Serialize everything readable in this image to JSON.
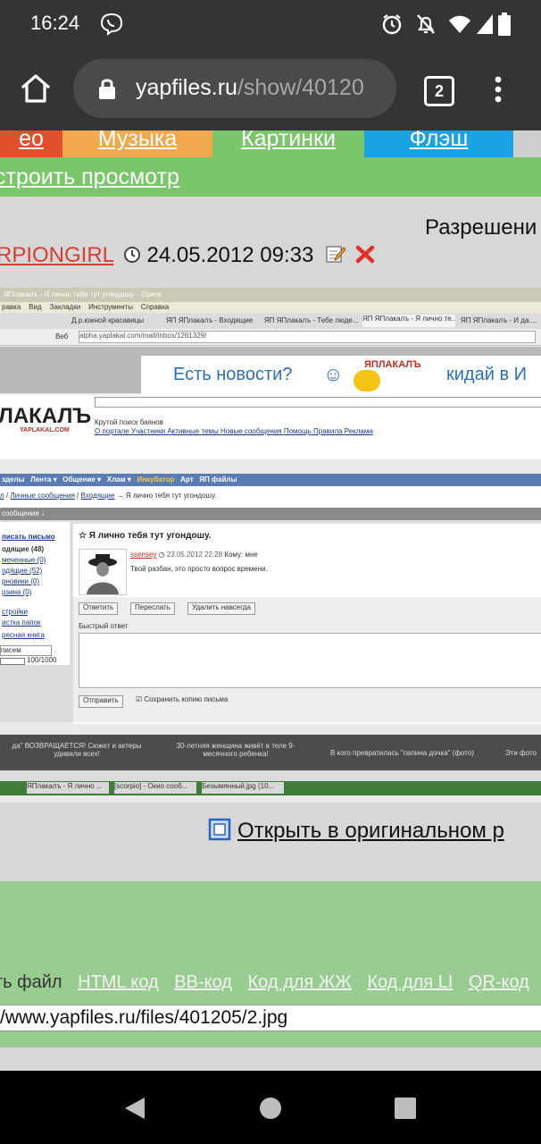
{
  "status_bar": {
    "time": "16:24"
  },
  "browser": {
    "url_host": "yapfiles.ru",
    "url_path": "/show/40120",
    "tab_count": "2"
  },
  "nav_tabs": [
    {
      "label": "ео",
      "color": "#e0502c"
    },
    {
      "label": "Музыка",
      "color": "#f2a84d"
    },
    {
      "label": "Картинки",
      "color": "#7bc66a"
    },
    {
      "label": "Флэш",
      "color": "#1aa3e2"
    }
  ],
  "settings_link": "строить просмотр",
  "permission_text": "Разрешени",
  "post": {
    "author": "RPIONGIRL",
    "date": "24.05.2012 09:33"
  },
  "screenshot": {
    "window_title": "ЯПлакалъ - Я лично тебя тут угондошу. - Opera",
    "menu": [
      "равка",
      "Вид",
      "Закладки",
      "Инструменты",
      "Справка"
    ],
    "tabs": [
      "Д.р.южной красавицы",
      "ЯП ЯПлакалъ - Входящие",
      "ЯП ЯПлакалъ - Тебе люде...",
      "ЯП ЯПлакалъ - Я лично те...",
      "ЯП ЯПлакалъ - И да...."
    ],
    "address": "alpha.yaplakal.com/mail/inbox/1261329/",
    "address_label": "Веб",
    "banner_left": "Есть новости?",
    "banner_logo": "ЯПЛАКАЛЪ",
    "banner_right": "кидай в И",
    "logo": "ЛАКАЛЪ",
    "logo_sub": "YAPLAKAL.COM",
    "search_caption": "Крутой поиск баянов",
    "top_links": [
      "О портале",
      "Участники",
      "Активные темы",
      "Новые сообщения",
      "Помощь",
      "Правила",
      "Реклама"
    ],
    "menu_bar": [
      "зделы",
      "Лента ▾",
      "Общение ▾",
      "Хлам ▾",
      "Инкубатор",
      "Арт",
      "ЯП файлы"
    ],
    "breadcrumb_links": [
      "л",
      "Личные сообщения",
      "Входящие"
    ],
    "breadcrumb_tail": "→ Я лично тебя тут угондошу.",
    "section_title": "сообщения ↓",
    "sidebar": [
      "писать письмо",
      "одящие (48)",
      "меченные (0)",
      "одящие (52)",
      "рновики (0)",
      "рзина (0)",
      "стройки",
      "истка папок",
      "ресная книга"
    ],
    "sidebar_input": "писем",
    "sidebar_progress": "100/1000",
    "message_title": "Я лично тебя тут угондошу.",
    "message_author": "ssensey",
    "message_date": "23.05.2012 22:28",
    "message_to": "Кому: мне",
    "message_body": "Твой разбан, это просто вопрос времени.",
    "btn_reply": "Ответить",
    "btn_forward": "Переслать",
    "btn_delete": "Удалить навсегда",
    "quick_reply": "Быстрый ответ",
    "btn_send": "Отправить",
    "save_copy": "Сохранить копию письма",
    "footer_news": [
      "да\" ВОЗВРАЩАЕТСЯ! Сюжет и актеры удивили всех!",
      "30-летняя женщина живёт в теле 9-месячного ребенка!",
      "В кого превратилась \"папина дочка\" (фото)",
      "Эти фото"
    ],
    "taskbar": [
      "ЯПлакалъ - Я лично ...",
      "[scorpio] - Окно сооб...",
      "Безымянный.jpg (10..."
    ]
  },
  "open_original": "Открыть в оригинальном р",
  "codes": {
    "label": "ть файл",
    "links": [
      "HTML код",
      "BB-код",
      "Код для ЖЖ",
      "Код для LI",
      "QR-код"
    ],
    "url": "/www.yapfiles.ru/files/401205/2.jpg"
  }
}
